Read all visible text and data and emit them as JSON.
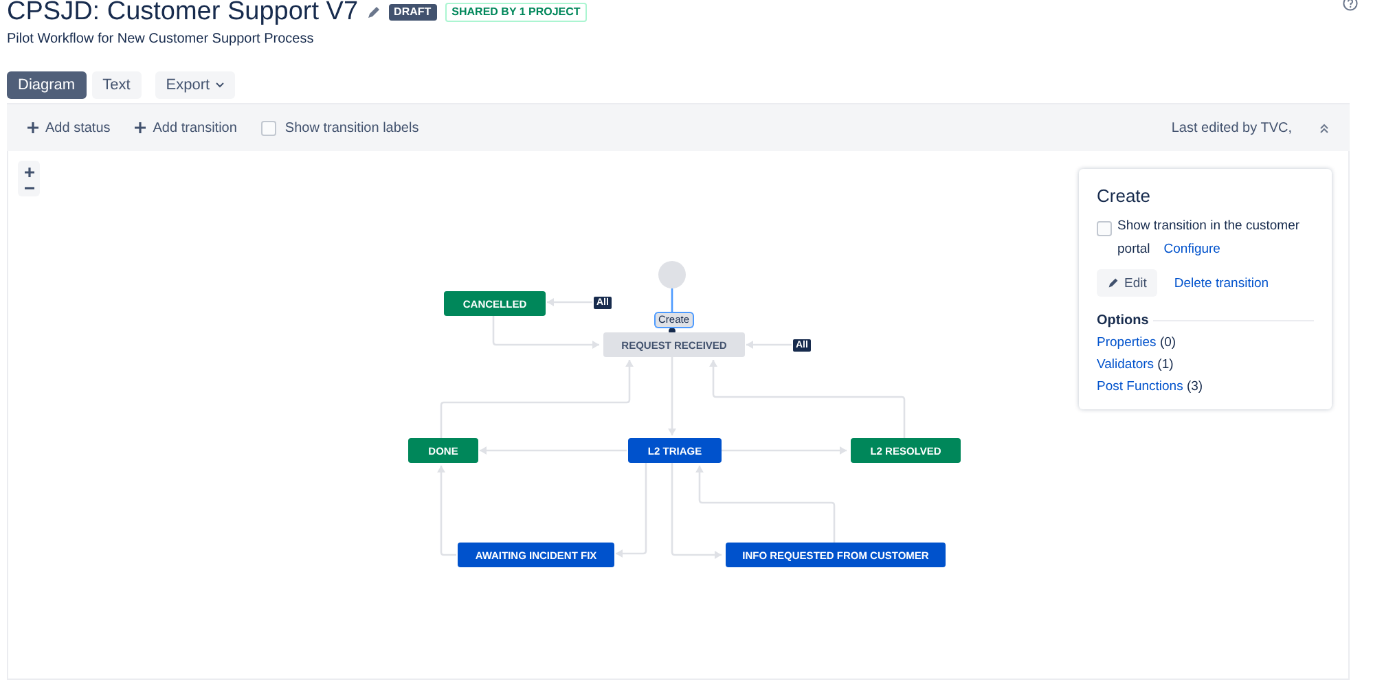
{
  "header": {
    "title": "CPSJD: Customer Support V7",
    "badges": [
      {
        "label": "DRAFT",
        "kind": "draft"
      },
      {
        "label": "SHARED BY 1 PROJECT",
        "kind": "shared"
      }
    ],
    "subtitle": "Pilot Workflow for New Customer Support Process"
  },
  "view_tabs": [
    {
      "label": "Diagram",
      "selected": true
    },
    {
      "label": "Text",
      "selected": false
    }
  ],
  "export_button": {
    "label": "Export"
  },
  "toolbar": {
    "add_status": "Add status",
    "add_transition": "Add transition",
    "show_labels": {
      "label": "Show transition labels",
      "checked": false
    },
    "last_edited": "Last edited by TVC,"
  },
  "diagram": {
    "nodes": [
      {
        "label": "CANCELLED",
        "kind": "done"
      },
      {
        "label": "REQUEST RECEIVED",
        "kind": "todo",
        "selected": false
      },
      {
        "label": "DONE",
        "kind": "done"
      },
      {
        "label": "L2 TRIAGE",
        "kind": "inprogress"
      },
      {
        "label": "L2 RESOLVED",
        "kind": "done"
      },
      {
        "label": "AWAITING INCIDENT FIX",
        "kind": "inprogress"
      },
      {
        "label": "INFO REQUESTED FROM CUSTOMER",
        "kind": "inprogress"
      }
    ],
    "global_transitions": [
      "All",
      "All"
    ],
    "selected_transition": {
      "label": "Create",
      "selected": true
    }
  },
  "panel": {
    "title": "Create",
    "show_in_portal": {
      "label": "Show transition in the customer portal",
      "checked": false,
      "link": "Configure"
    },
    "edit_button": "Edit",
    "delete_link": "Delete transition",
    "options_heading": "Options",
    "options": [
      {
        "label": "Properties",
        "count": "(0)"
      },
      {
        "label": "Validators",
        "count": "(1)"
      },
      {
        "label": "Post Functions",
        "count": "(3)"
      }
    ]
  }
}
